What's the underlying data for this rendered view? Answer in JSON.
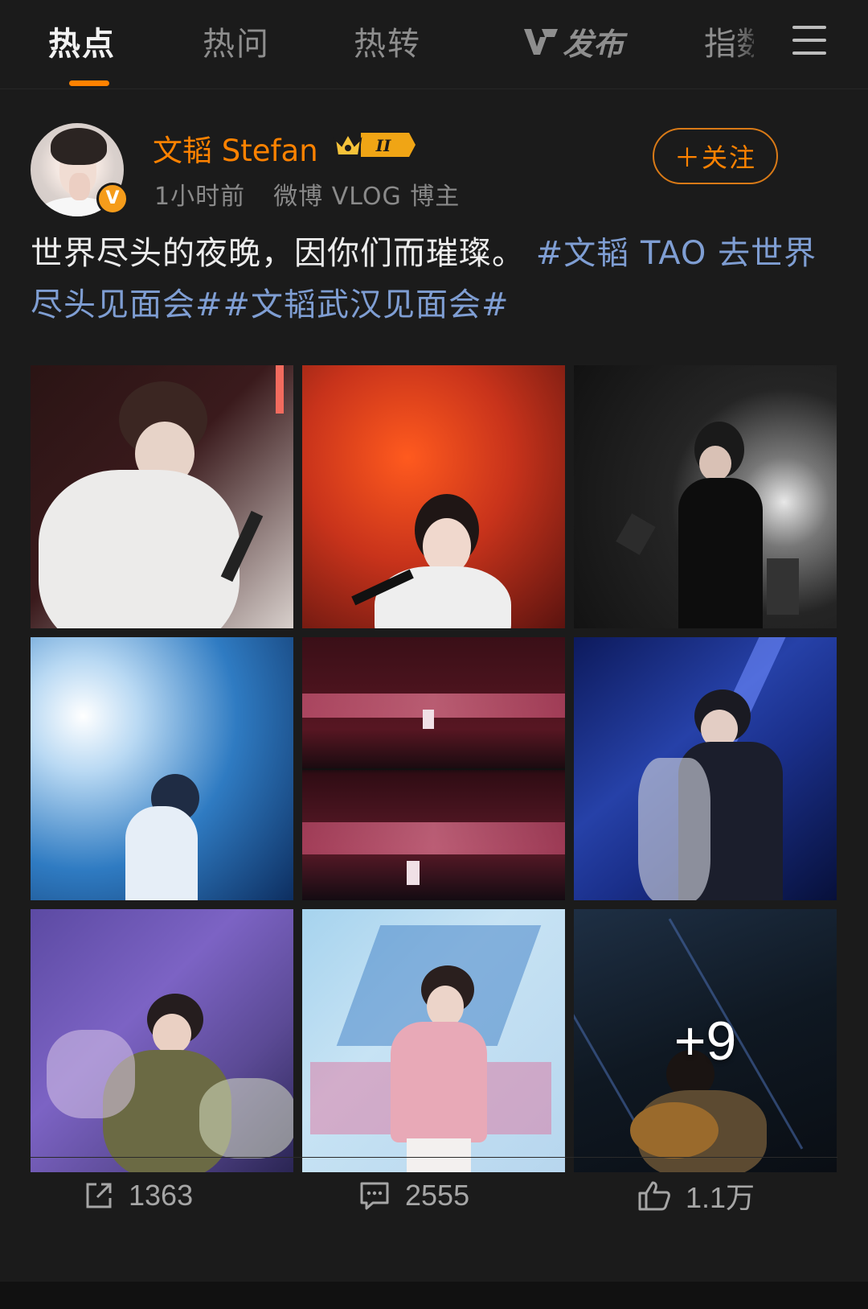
{
  "tabs": {
    "hot": "热点",
    "ask": "热问",
    "repost": "热转",
    "publish": "发布",
    "guide": "指数"
  },
  "colors": {
    "accent": "#ff8200",
    "hashtag": "#7f9ed3",
    "background": "#1b1b1b"
  },
  "post": {
    "author": "文韬 Stefan",
    "level_badge": "II",
    "time": "1小时前",
    "author_tag": "微博 VLOG 博主",
    "follow_label": "＋关注",
    "text": "世界尽头的夜晚，因你们而璀璨。",
    "hashtags": "#文韬 TAO 去世界尽头见面会##文韬武汉见面会#",
    "more_photos": "+9"
  },
  "actions": {
    "share_count": "1363",
    "comment_count": "2555",
    "like_count": "1.1万"
  },
  "icons": {
    "menu": "hamburger-menu-icon",
    "verified": "verified-v-badge-icon",
    "level": "crown-level-badge-icon",
    "share": "share-icon",
    "comment": "comment-icon",
    "like": "thumbs-up-icon"
  }
}
